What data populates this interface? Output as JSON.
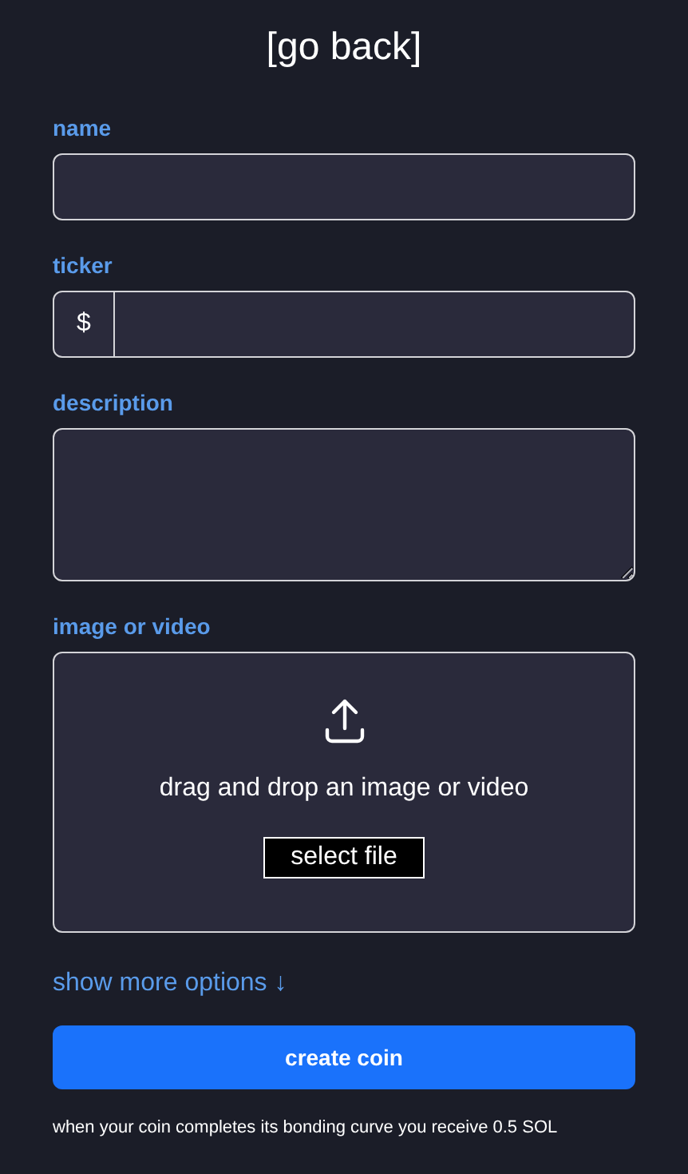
{
  "back_link": "[go back]",
  "fields": [
    {
      "kind": "text",
      "label": "name"
    },
    {
      "kind": "ticker",
      "label": "ticker",
      "prefix": "$"
    },
    {
      "kind": "textarea",
      "label": "description"
    },
    {
      "kind": "upload",
      "label": "image or video",
      "prompt": "drag and drop an image or video",
      "button": "select file"
    }
  ],
  "more_options": "show more options ↓",
  "submit": "create coin",
  "note": "when your coin completes its bonding curve you receive 0.5 SOL"
}
